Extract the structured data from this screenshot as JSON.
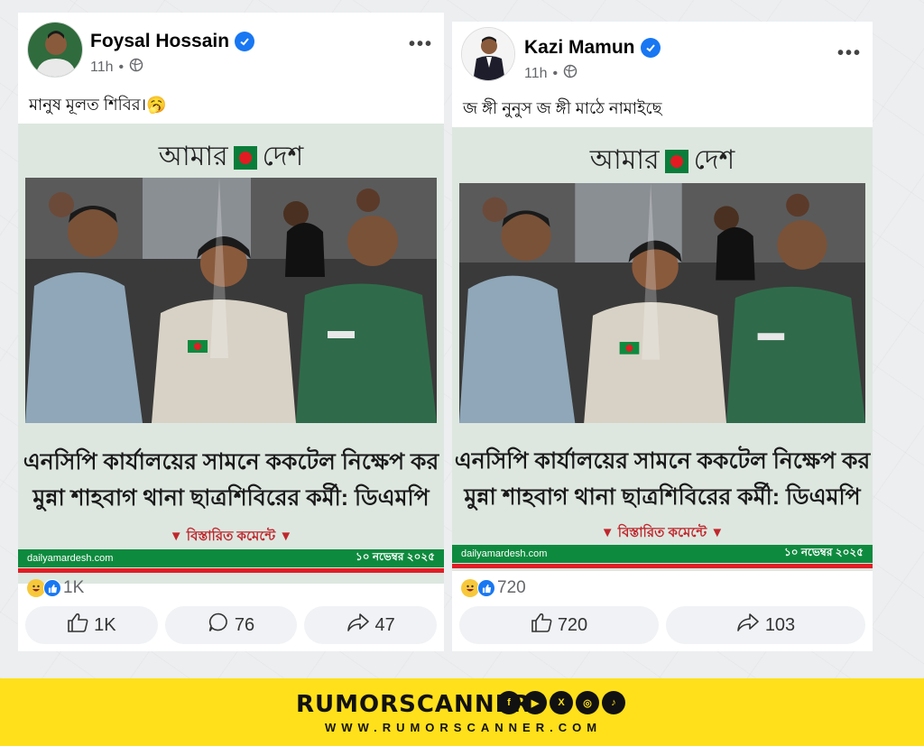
{
  "posts": [
    {
      "author": "Foysal Hossain",
      "time": "11h",
      "caption": "মানুষ মূলত শিবির।🥱",
      "news": {
        "masthead_left": "আমার",
        "masthead_right": "দেশ",
        "headline_line1": "এনসিপি কার্যালয়ের সামনে ককটেল নিক্ষেপ কর",
        "headline_line2": "মুন্না শাহবাগ থানা ছাত্রশিবিরের কর্মী: ডিএমপি",
        "details": "বিস্তারিত কমেন্টে",
        "site": "dailyamardesh.com",
        "date": "১০ নভেম্বর ২০২৫"
      },
      "reaction_count": "1K",
      "actions": [
        {
          "icon": "like-icon",
          "label": "1K"
        },
        {
          "icon": "comment-icon",
          "label": "76"
        },
        {
          "icon": "share-icon",
          "label": "47"
        }
      ]
    },
    {
      "author": "Kazi Mamun",
      "time": "11h",
      "caption": "জ ঙ্গী নুনুস জ ঙ্গী মাঠে নামাইছে",
      "news": {
        "masthead_left": "আমার",
        "masthead_right": "দেশ",
        "headline_line1": "এনসিপি কার্যালয়ের সামনে ককটেল নিক্ষেপ কর",
        "headline_line2": "মুন্না শাহবাগ থানা ছাত্রশিবিরের কর্মী: ডিএমপি",
        "details": "বিস্তারিত কমেন্টে",
        "site": "dailyamardesh.com",
        "date": "১০ নভেম্বর ২০২৫"
      },
      "reaction_count": "720",
      "actions": [
        {
          "icon": "like-icon",
          "label": "720"
        },
        {
          "icon": "share-icon",
          "label": "103"
        }
      ]
    }
  ],
  "brand": {
    "name": "RUMORSCANNER",
    "url": "WWW.RUMORSCANNER.COM",
    "socials": [
      "facebook-icon",
      "youtube-icon",
      "x-icon",
      "instagram-icon",
      "tiktok-icon"
    ]
  },
  "colors": {
    "verified": "#1877f2",
    "news_bg": "#dde7e0",
    "news_green": "#0e8a3e",
    "news_red": "#e11d25",
    "brand_yellow": "#ffe01b"
  }
}
